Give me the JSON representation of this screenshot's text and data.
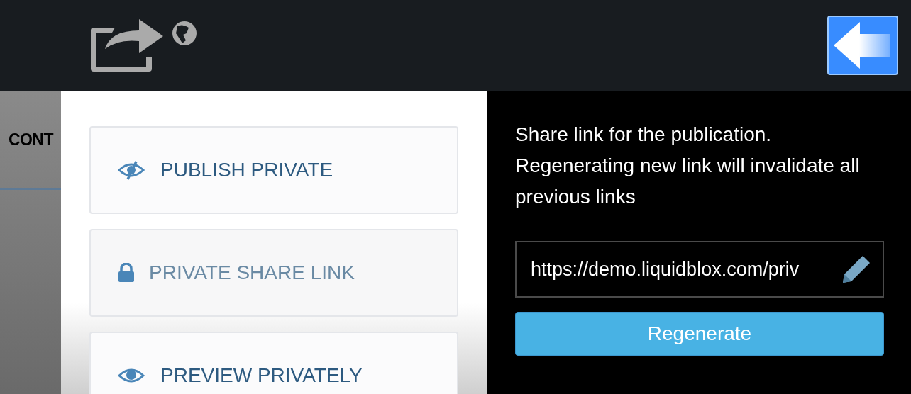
{
  "background": {
    "nav_label": "CONT"
  },
  "options": [
    {
      "kind": "eye-slash",
      "label": "PUBLISH PRIVATE",
      "selected": false
    },
    {
      "kind": "lock",
      "label": "PRIVATE SHARE LINK",
      "selected": true
    },
    {
      "kind": "eye",
      "label": "PREVIEW PRIVATELY",
      "selected": false
    }
  ],
  "share_panel": {
    "description": "Share link for the publication. Regenerating new link will invalidate all previous links",
    "link_value": "https://demo.liquidblox.com/priv",
    "regenerate_button": "Regenerate"
  }
}
